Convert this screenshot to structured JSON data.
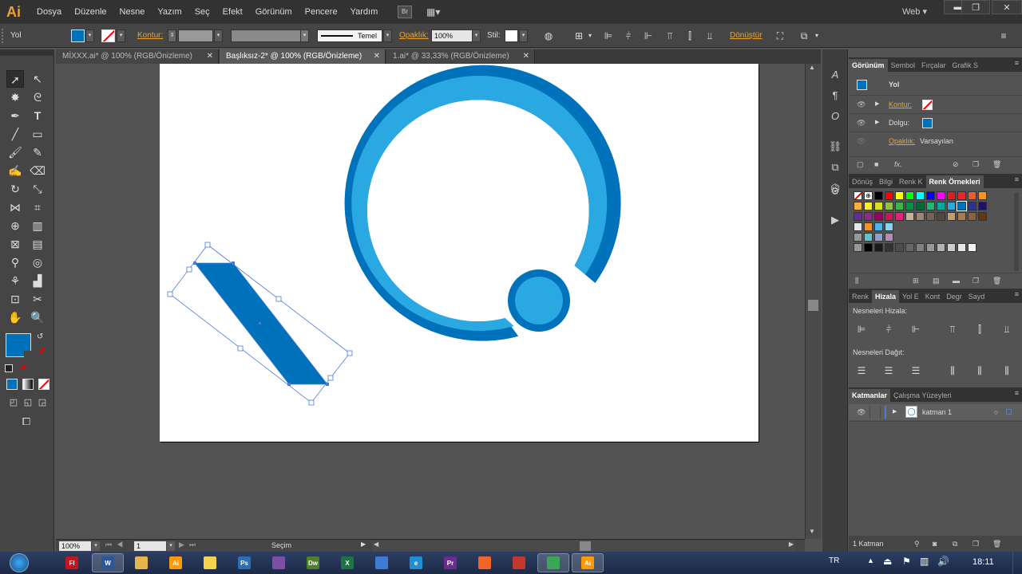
{
  "app": {
    "logo": "Ai",
    "workspace": "Web ▾"
  },
  "menu": [
    "Dosya",
    "Düzenle",
    "Nesne",
    "Yazım",
    "Seç",
    "Efekt",
    "Görünüm",
    "Pencere",
    "Yardım"
  ],
  "window_controls": {
    "minimize": "▬",
    "restore": "❐",
    "close": "✕"
  },
  "control": {
    "selection_label": "Yol",
    "stroke_label": "Kontur:",
    "stroke_profile": "Temel",
    "opacity_label": "Opaklık:",
    "opacity_value": "100%",
    "style_label": "Stil:",
    "transform_label": "Dönüştür"
  },
  "tabs": [
    {
      "label": "MİXXX.ai* @ 100% (RGB/Önizleme)",
      "close": "✕"
    },
    {
      "label": "Başlıksız-2* @ 100% (RGB/Önizleme)",
      "close": "✕"
    },
    {
      "label": "1.ai* @ 33,33% (RGB/Önizleme)",
      "close": "✕"
    }
  ],
  "colors": {
    "dark_blue": "#0072bc",
    "light_blue": "#29a8e2",
    "fill": "#0072bc"
  },
  "statusbar": {
    "zoom": "100%",
    "artboard": "1",
    "tool": "Seçim"
  },
  "appearance": {
    "tabs": [
      "Görünüm",
      "Sembol",
      "Fırçalar",
      "Grafik S"
    ],
    "title": "Yol",
    "stroke_label": "Kontur:",
    "fill_label": "Dolgu:",
    "opacity_label": "Opaklık:",
    "opacity_value": "Varsayılan"
  },
  "swatches_panel": {
    "tabs": [
      "Dönüş",
      "Bilgi",
      "Renk K",
      "Renk Örnekleri"
    ]
  },
  "align_panel": {
    "tabs": [
      "Renk",
      "Hizala",
      "Yol E",
      "Kont",
      "Degr",
      "Sayd"
    ],
    "align_objects": "Nesneleri Hizala:",
    "distribute_objects": "Nesneleri Dağıt:"
  },
  "layers_panel": {
    "tabs": [
      "Katmanlar",
      "Çalışma Yüzeyleri"
    ],
    "layer_name": "katman 1",
    "footer": "1 Katman"
  },
  "taskbar": {
    "language": "TR",
    "time": "18:11"
  }
}
